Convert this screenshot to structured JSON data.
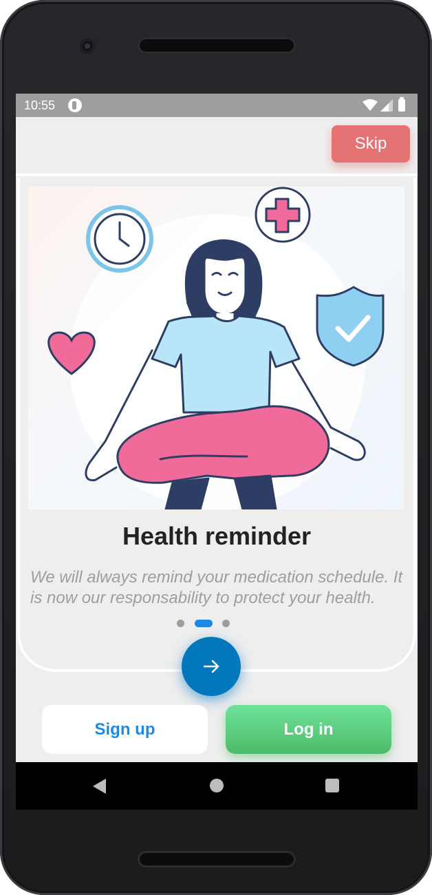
{
  "status_bar": {
    "time": "10:55",
    "icons": [
      "app-notification-icon",
      "wifi-icon",
      "signal-icon",
      "battery-icon"
    ]
  },
  "header": {
    "skip_label": "Skip"
  },
  "slide": {
    "title": "Health reminder",
    "description": "We will always remind your medication schedule. It is now our responsability to protect your health.",
    "illustration_icons": [
      "clock-icon",
      "medical-cross-icon",
      "heart-icon",
      "shield-check-icon",
      "meditating-person-illustration"
    ],
    "page_count": 3,
    "active_page": 2
  },
  "next_button": {
    "icon": "arrow-right-icon"
  },
  "actions": {
    "signup_label": "Sign up",
    "login_label": "Log in"
  },
  "nav_bar": {
    "icons": [
      "back-icon",
      "home-icon",
      "recents-icon"
    ]
  },
  "colors": {
    "skip": "#e57373",
    "accent_blue": "#1e88e5",
    "fab": "#0277bd",
    "login_green": "#4cbb67",
    "background": "#eeeeee"
  }
}
